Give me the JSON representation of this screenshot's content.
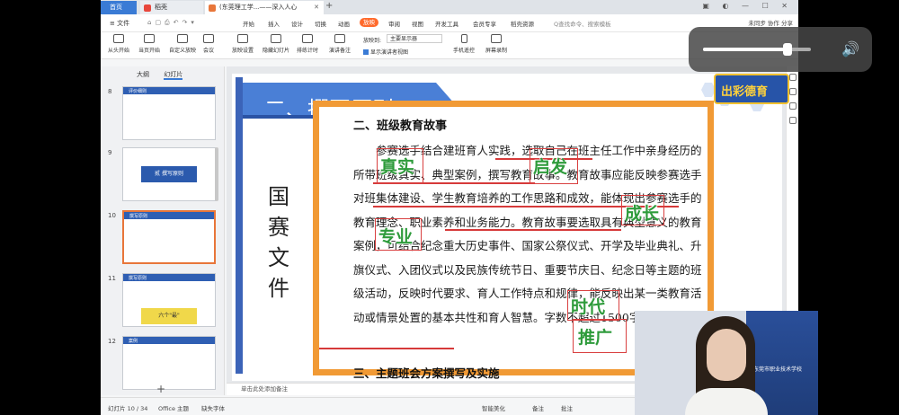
{
  "tabs": {
    "home": "首页",
    "t1": "稻壳",
    "t2": "(东莞理工学...——深入人心"
  },
  "menu": {
    "file": "文件",
    "tabs": [
      "开始",
      "插入",
      "设计",
      "切换",
      "动画",
      "放映",
      "审阅",
      "视图",
      "开发工具",
      "会员专享",
      "稻壳资源"
    ],
    "active_index": 5,
    "search": "Q查找命令、搜索模板",
    "right": "未同步  协作  分享"
  },
  "toolbar": {
    "buttons": [
      "从头开始",
      "当页开始",
      "自定义放映",
      "会议",
      "放映设置",
      "隐藏幻灯片",
      "排练计时",
      "演讲备注"
    ],
    "monitor_label": "放映到:",
    "monitor_value": "主要显示器",
    "presenter_view": "显示演讲者视图",
    "phone_remote": "手机遥控",
    "screen_record": "屏幕录制"
  },
  "panel": {
    "tab_outline": "大纲",
    "tab_slides": "幻灯片",
    "slides": [
      {
        "num": "8",
        "label": "评价细则"
      },
      {
        "num": "9",
        "label": "撰写原则",
        "big": "贰 撰写原则"
      },
      {
        "num": "10",
        "label": "撰写原则",
        "selected": true
      },
      {
        "num": "11",
        "label": "撰写原则",
        "big": "六个\"最\""
      },
      {
        "num": "12",
        "label": "案例"
      }
    ]
  },
  "slide": {
    "title": "二、撰写原则",
    "side_title": "国赛文件",
    "heading": "二、班级教育故事",
    "paragraph": "参赛选手结合建班育人实践，选取自己在班主任工作中亲身经历的所带班级真实、典型案例，撰写教育故事。教育故事应能反映参赛选手对班集体建设、学生教育培养的工作思路和成效，能体现出参赛选手的教育理念、职业素养和业务能力。教育故事要选取具有典型意义的教育案例，可结合纪念重大历史事件、国家公祭仪式、开学及毕业典礼、升旗仪式、入团仪式以及民族传统节日、重要节庆日、纪念日等主题的班级活动，反映时代要求、育人工作特点和规律，能反映出某一类教育活动或情景处置的基本共性和育人智慧。字数不超过1500字。",
    "tail": "三、主题班会方案撰写及实施",
    "stamps": [
      "真实",
      "启发",
      "成长",
      "专业",
      "时代",
      "推广"
    ]
  },
  "notes_placeholder": "单击此处添加备注",
  "status": {
    "slide": "幻灯片 10 / 34",
    "theme": "Office 主题",
    "font": "缺失字体",
    "smart": "智能美化",
    "notes": "备注",
    "comment": "批注"
  },
  "overlay": {
    "volume_level": 0.78,
    "badge": "出彩德育",
    "cam_text": "东莞市职业技术学校"
  }
}
